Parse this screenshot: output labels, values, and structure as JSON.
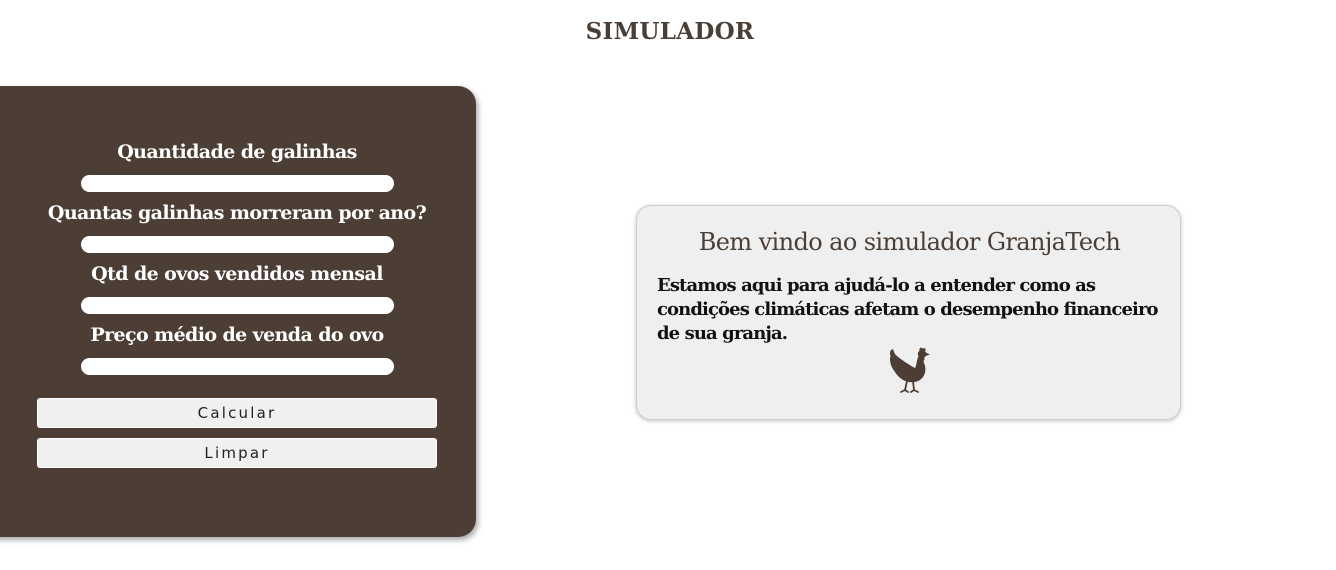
{
  "page": {
    "title": "SIMULADOR"
  },
  "form": {
    "fields": [
      {
        "label": "Quantidade de galinhas",
        "value": ""
      },
      {
        "label": "Quantas galinhas morreram por ano?",
        "value": ""
      },
      {
        "label": "Qtd de ovos vendidos mensal",
        "value": ""
      },
      {
        "label": "Preço médio de venda do ovo",
        "value": ""
      }
    ],
    "buttons": {
      "calculate": "Calcular",
      "clear": "Limpar"
    }
  },
  "welcome": {
    "title": "Bem vindo ao simulador GranjaTech",
    "text": "Estamos aqui para ajudá-lo a entender como as condições climáticas afetam o desempenho financeiro de sua granja.",
    "icon": "hen-icon"
  },
  "colors": {
    "panel": "#4c3e35",
    "accent_text": "#4a3f37",
    "card": "#efefef"
  }
}
